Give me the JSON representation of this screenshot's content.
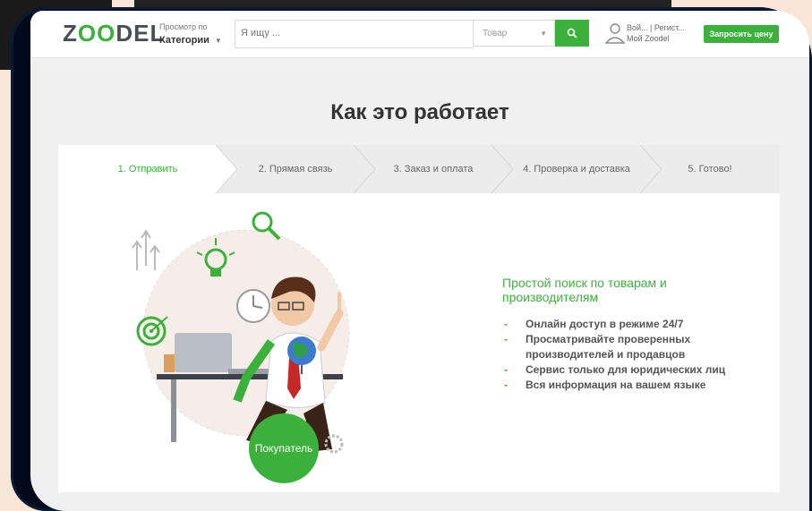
{
  "header": {
    "logo": {
      "before": "Z",
      "middle": "OO",
      "after": "DEL"
    },
    "browse_small": "Просмотр по",
    "browse_big": "Категории",
    "search_placeholder": "Я ищу ...",
    "category_value": "Товар",
    "user_line1": "Вой... | Регист...",
    "user_line2": "Мой Zoodel",
    "quote_button": "Запросить цену"
  },
  "main": {
    "title": "Как это работает",
    "steps": [
      {
        "label": "1. Отправить"
      },
      {
        "label": "2. Прямая связь"
      },
      {
        "label": "3. Заказ и оплата"
      },
      {
        "label": "4. Проверка и доставка"
      },
      {
        "label": "5. Готово!"
      }
    ],
    "active_step": 1,
    "lead": "Простой поиск по товарам и производителям",
    "bullets": [
      "Онлайн доступ в режиме 24/7",
      "Просматривайте проверенных производителей и продавцов",
      "Сервис только для юридических лиц",
      "Вся информация на вашем языке"
    ],
    "buyer_label": "Покупатель"
  },
  "colors": {
    "accent": "#3bb13b",
    "bezel": "#030a1b",
    "page_bg": "#f0f0f0",
    "tab_inactive": "#ececec",
    "tab_active": "#ffffff"
  },
  "icons": [
    "search-icon",
    "user-icon",
    "chevron-down-icon",
    "lightbulb-icon",
    "magnifier-icon",
    "target-icon",
    "clock-icon",
    "globe-icon",
    "laptop-icon"
  ]
}
